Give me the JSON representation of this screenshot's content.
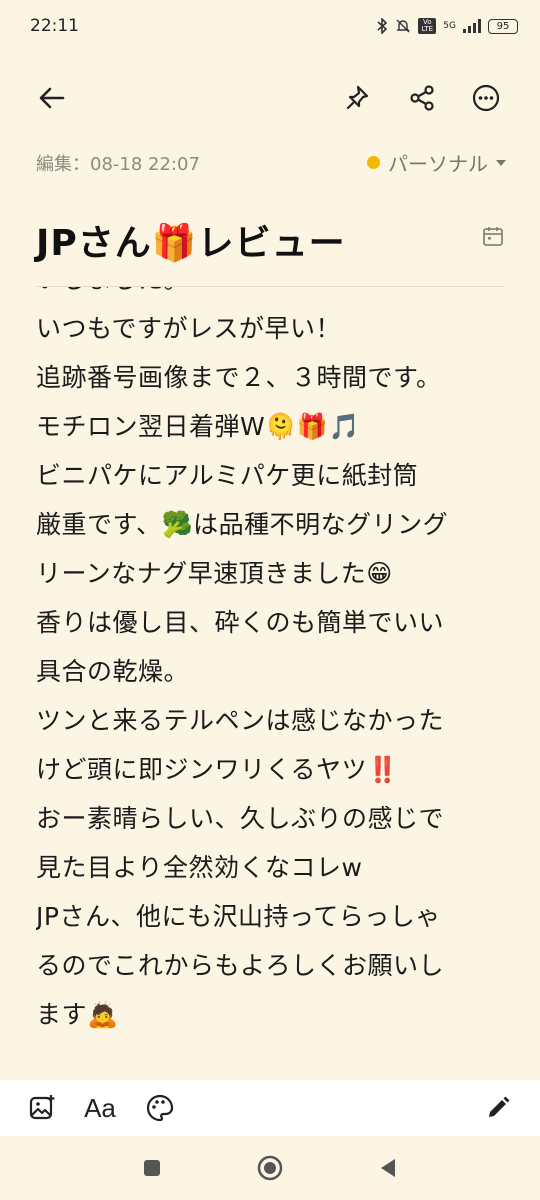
{
  "status_bar": {
    "time": "22:11",
    "network": "5G",
    "volte": "Vo LTE",
    "battery": "95"
  },
  "toolbar": {
    "icons": [
      "back-arrow-icon",
      "pin-icon",
      "share-icon",
      "more-icon"
    ]
  },
  "meta": {
    "edited": "編集：08-18 22:07",
    "folder": "パーソナル",
    "folder_color": "#f5b800"
  },
  "note": {
    "title": "JPさん🎁レビュー",
    "lines": [
      "いしました。",
      "いつもですがレスが早い！",
      "追跡番号画像まで２、３時間です。",
      "モチロン翌日着弾W🫠🎁🎵",
      "ビニパケにアルミパケ更に紙封筒",
      "厳重です、🥦は品種不明なグリング",
      "リーンなナグ早速頂きました😁",
      "香りは優し目、砕くのも簡単でいい",
      "具合の乾燥。",
      "ツンと来るテルペンは感じなかった",
      "けど頭に即ジンワリくるヤツ‼️",
      "おー素晴らしい、久しぶりの感じで",
      "見た目より全然効くなコレw",
      "JPさん、他にも沢山持ってらっしゃ",
      "るのでこれからもよろしくお願いし",
      "ます🙇"
    ]
  },
  "bottom_toolbar": {
    "text_format_label": "Aa"
  },
  "colors": {
    "background": "#fdf5e3",
    "bottom_bar": "#ffffff",
    "text": "#1b1b1b",
    "meta_text": "#8f8a80"
  }
}
